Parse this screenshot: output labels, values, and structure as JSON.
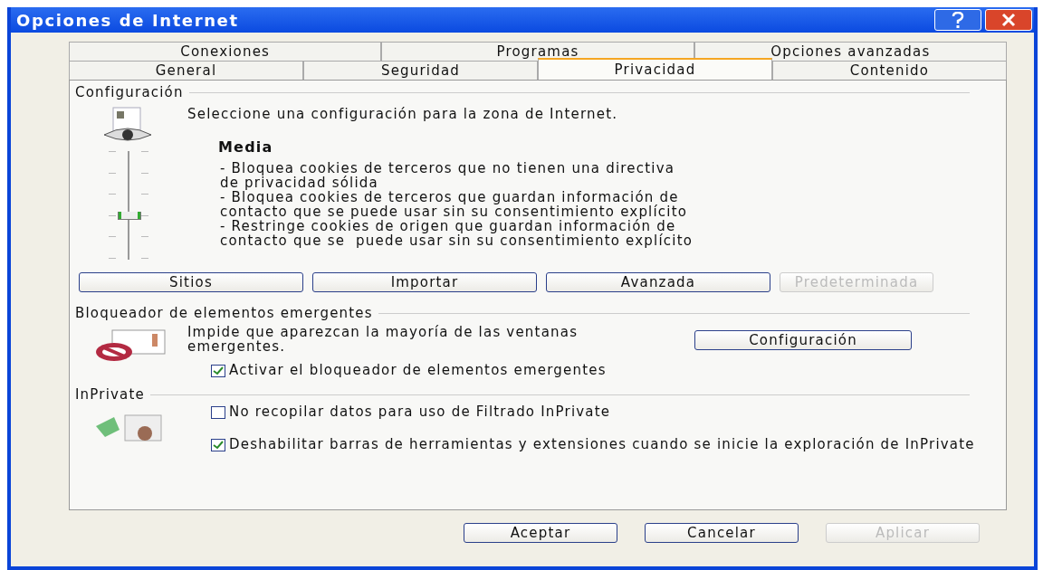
{
  "window": {
    "title": "Opciones de Internet"
  },
  "tab_rows": [
    [
      {
        "label": "Conexiones",
        "selected": false
      },
      {
        "label": "Programas",
        "selected": false
      },
      {
        "label": "Opciones avanzadas",
        "selected": false
      }
    ],
    [
      {
        "label": "General",
        "selected": false
      },
      {
        "label": "Seguridad",
        "selected": false
      },
      {
        "label": "Privacidad",
        "selected": true
      },
      {
        "label": "Contenido",
        "selected": false
      }
    ]
  ],
  "settings": {
    "title": "Configuración",
    "description": "Seleccione una configuración para la zona de Internet.",
    "level_name": "Media",
    "slider": {
      "level": 0.4
    },
    "details": [
      "- Bloquea cookies de terceros que no tienen una directiva",
      "de privacidad sólida",
      "- Bloquea cookies de terceros que guardan información de",
      "contacto que se puede usar sin su consentimiento explícito",
      "- Restringe cookies de origen que guardan información de",
      "contacto que se  puede usar sin su consentimiento explícito"
    ],
    "buttons": [
      {
        "label": "Sitios",
        "disabled": false
      },
      {
        "label": "Importar",
        "disabled": false
      },
      {
        "label": "Avanzada",
        "disabled": false
      },
      {
        "label": "Predeterminada",
        "disabled": true
      }
    ]
  },
  "popup_blocker": {
    "title": "Bloqueador de elementos emergentes",
    "description": "Impide que aparezcan la mayoría de las ventanas emergentes.",
    "button": "Configuración",
    "checkbox": {
      "label": "Activar el bloqueador de elementos emergentes",
      "checked": true
    }
  },
  "inprivate": {
    "title": "InPrivate",
    "checkboxes": [
      {
        "label": "No recopilar datos para uso de Filtrado InPrivate",
        "checked": false
      },
      {
        "label": "Deshabilitar barras de herramientas y extensiones cuando se inicie la exploración de InPrivate",
        "checked": true
      }
    ]
  },
  "footer_buttons": [
    {
      "label": "Aceptar",
      "disabled": false
    },
    {
      "label": "Cancelar",
      "disabled": false
    },
    {
      "label": "Aplicar",
      "disabled": true
    }
  ]
}
